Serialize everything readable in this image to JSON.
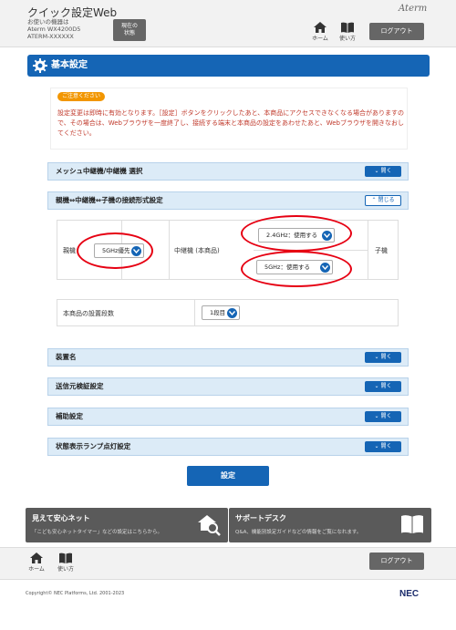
{
  "header": {
    "title": "クイック設定Web",
    "device_lines": [
      "お使いの機器は",
      "Aterm  WX4200D5",
      "ATERM-XXXXXX"
    ],
    "status_btn": [
      "現在の",
      "状態"
    ],
    "brand": "Aterm",
    "home_label": "ホーム",
    "manual_label": "使い方",
    "logout_label": "ログアウト"
  },
  "page": {
    "section_title": "基本設定",
    "notice_badge": "ご注意ください",
    "notice_text": "設定変更は即時に有効となります。［設定］ボタンをクリックしたあと、本商品にアクセスできなくなる場合がありますので、その場合は、Webブラウザを一度終了し、接続する端末と本商品の設定をあわせたあと、Webブラウザを開きなおしてください。",
    "open_label": "開く",
    "close_label": "閉じる",
    "accordions": {
      "mesh": "メッシュ中継機/中継機 選択",
      "conn": "親機⇔中継機⇔子機の接続形式設定",
      "device_name": "装置名",
      "sender_check": "送信元検証設定",
      "aux": "補助設定",
      "lamp": "状態表示ランプ点灯設定"
    },
    "conn_table": {
      "parent_label": "親機",
      "parent_value": "5GHz優先",
      "relay_label": "中継機 (本商品)",
      "relay_24": "2.4GHz：使用する",
      "relay_5": "5GHz：使用する",
      "child_label": "子機"
    },
    "stage": {
      "label": "本商品の設置段数",
      "value": "1段目"
    },
    "apply_label": "設定"
  },
  "promos": {
    "left_title": "見えて安心ネット",
    "left_desc": "「こども安心ネットタイマー」などの設定はこちらから。",
    "right_title": "サポートデスク",
    "right_desc": "Q&A、機能別設定ガイドなどの情報をご覧になれます。"
  },
  "footer": {
    "home_label": "ホーム",
    "manual_label": "使い方",
    "logout_label": "ログアウト",
    "copyright": "Copyright© NEC Platforms, Ltd. 2001-2023",
    "nec": "NEC"
  },
  "colors": {
    "accent": "#1565b5",
    "alert_text": "#c0392b",
    "highlight_ring": "#e60012"
  }
}
